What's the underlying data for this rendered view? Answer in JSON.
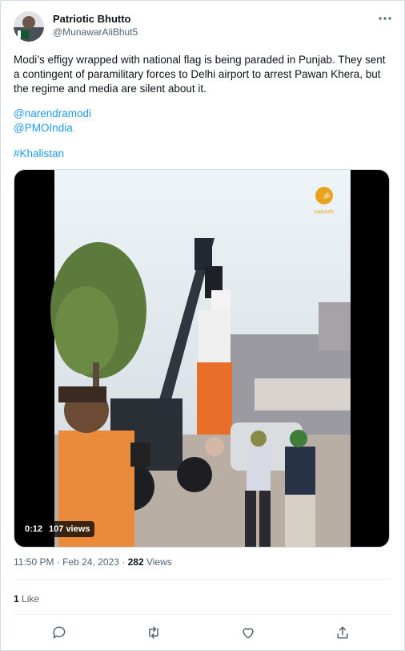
{
  "author": {
    "display_name": "Patriotic Bhutto",
    "handle": "@MunawarAliBhut5"
  },
  "tweet": {
    "text": "Modi’s effigy wrapped with national flag is being paraded in Punjab. They sent a contingent of paramilitary forces to Delhi airport to arrest Pawan Khera, but the regime and media are silent about it.",
    "mentions": [
      "@narendramodi",
      "@PMOIndia"
    ],
    "hashtag": "#Khalistan"
  },
  "video": {
    "time": "0:12",
    "views": "107 views",
    "watermark": "malistuffs"
  },
  "meta": {
    "time": "11:50 PM",
    "date": "Feb 24, 2023",
    "separator": "·",
    "views_count": "282",
    "views_label": "Views"
  },
  "likes": {
    "count": "1",
    "label": "Like"
  },
  "icons": [
    "more-icon",
    "reply-icon",
    "retweet-icon",
    "like-icon",
    "share-icon"
  ],
  "colors": {
    "link": "#1d9bf0",
    "secondary": "#536471"
  }
}
